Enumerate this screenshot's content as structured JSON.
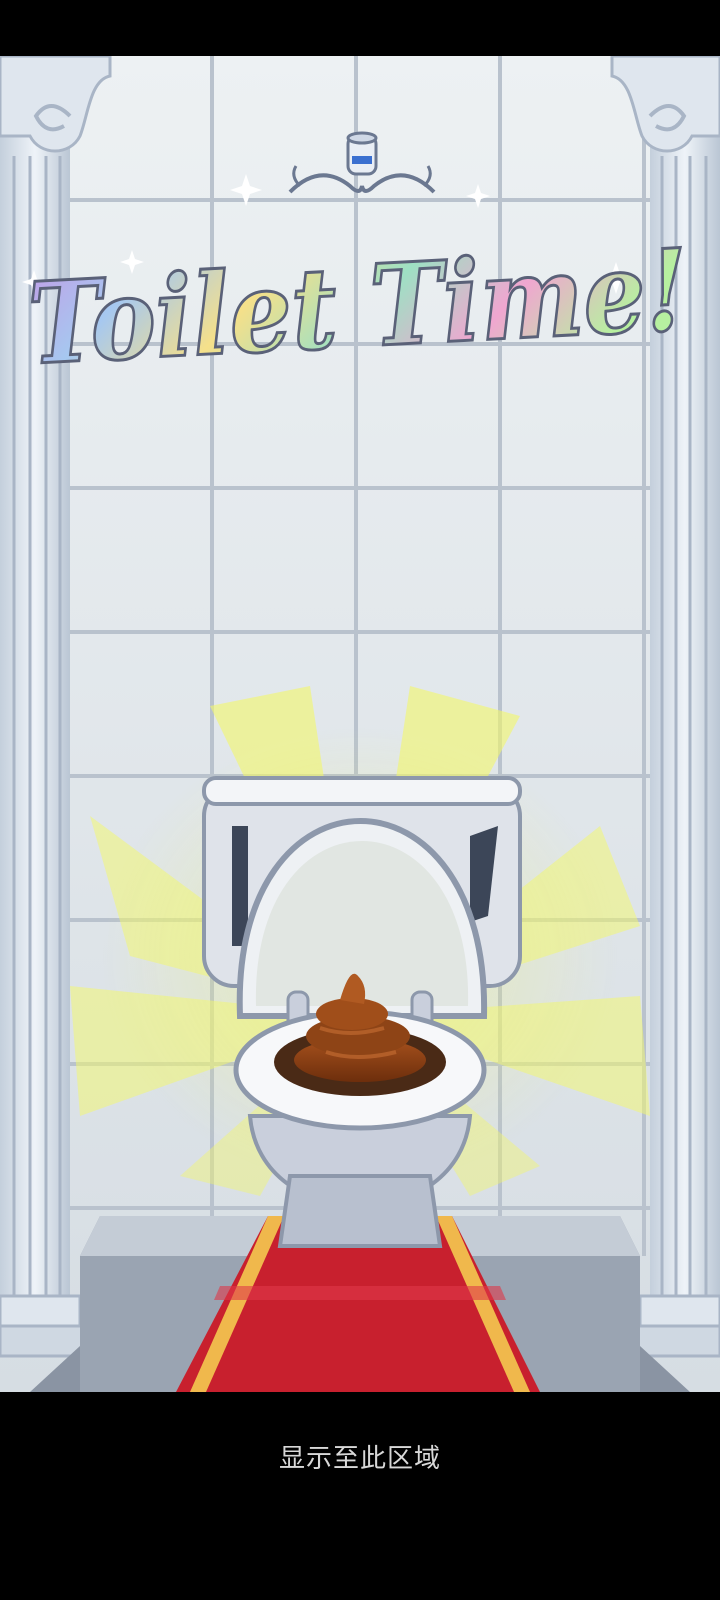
{
  "game": {
    "title": "Toilet Time!",
    "screen": "title-screen"
  },
  "scene": {
    "colors": {
      "tile": "#e3e8ec",
      "grout": "#b9c2cd",
      "pillar": "#e6ecf3",
      "pillar_shadow": "#b6c1d0",
      "glow": "#f4f86a",
      "carpet": "#c8202e",
      "carpet_stripe": "#f0b84c",
      "pedestal": "#9aa4b2",
      "toilet": "#dfe3ea",
      "toilet_outline": "#8d98ab",
      "poop": "#8a3f14"
    },
    "icons": [
      "toilet-paper-icon",
      "sparkle-icon",
      "toilet-icon",
      "poop-icon"
    ]
  },
  "footer": {
    "label": "显示至此区域"
  }
}
